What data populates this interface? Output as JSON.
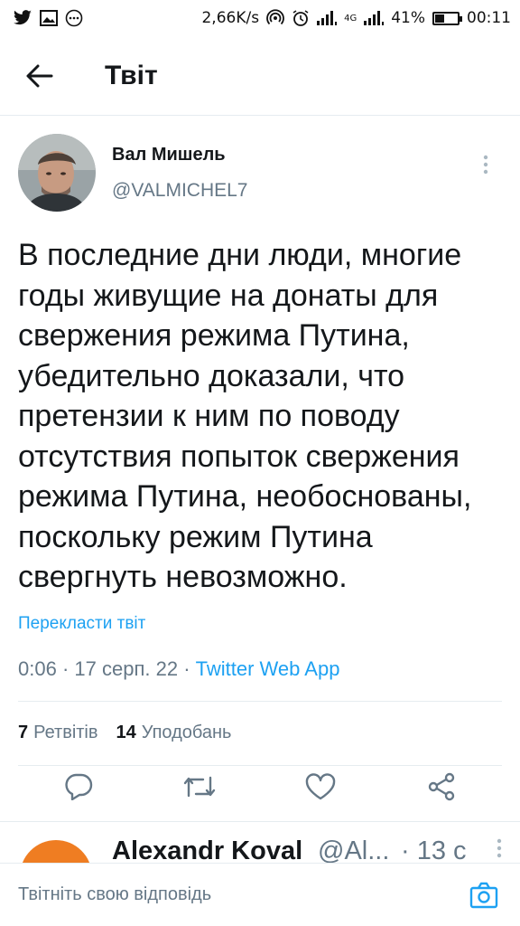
{
  "status_bar": {
    "network_speed": "2,66K/s",
    "network_type": "4G",
    "battery_percent": "41%",
    "battery_level": 0.41,
    "time": "00:11",
    "icons": [
      "twitter-icon",
      "image-icon",
      "more-dots-icon",
      "hotspot-icon",
      "alarm-icon",
      "signal-icon",
      "signal-4g-icon",
      "battery-icon"
    ]
  },
  "header": {
    "title": "Твіт",
    "back_icon": "arrow-left-icon"
  },
  "tweet": {
    "author_name": "Вал Мишель",
    "author_handle": "@VALMICHEL7",
    "text": "В последние дни люди, многие годы живущие на донаты для свержения режима Путина, убедительно доказали, что претензии к ним по поводу отсутствия попыток свержения режима Путина, необоснованы, поскольку режим Путина свергнуть невозможно.",
    "translate_label": "Перекласти твіт",
    "time": "0:06",
    "date": "17 серп. 22",
    "separator": "·",
    "source": "Twitter Web App",
    "retweets_count": "7",
    "retweets_label": "Ретвітів",
    "likes_count": "14",
    "likes_label": "Уподобань"
  },
  "actions": [
    "reply-icon",
    "retweet-icon",
    "like-icon",
    "share-icon"
  ],
  "reply_peek": {
    "name": "Alexandr Koval",
    "handle": "@Al...",
    "time": "· 13 с"
  },
  "reply_bar": {
    "placeholder": "Твітніть свою відповідь",
    "camera_icon": "camera-icon"
  },
  "colors": {
    "accent": "#1da1f2",
    "secondary_text": "#657786",
    "primary_text": "#14171a",
    "divider": "#e6ecf0",
    "reply_avatar": "#ef7d22"
  }
}
